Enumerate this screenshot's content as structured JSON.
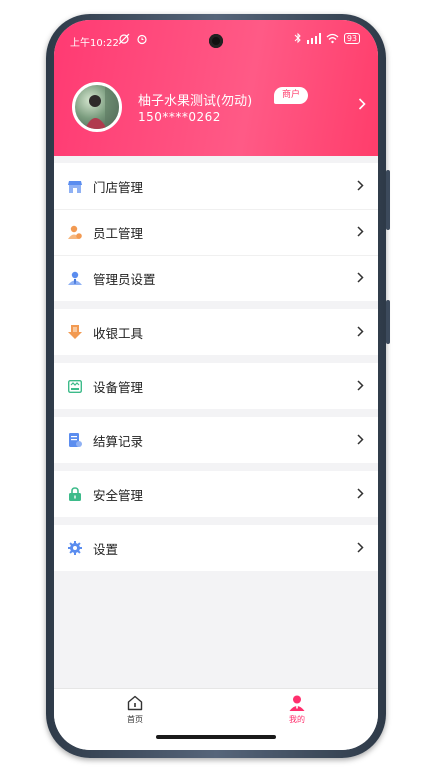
{
  "status_bar": {
    "time": "上午10:22",
    "battery": "93"
  },
  "profile": {
    "name": "柚子水果测试(勿动)",
    "role_badge": "商户",
    "phone": "150****0262"
  },
  "menu": {
    "groups": [
      [
        {
          "label": "门店管理",
          "icon": "store-icon",
          "color": "#5b8def"
        },
        {
          "label": "员工管理",
          "icon": "staff-icon",
          "color": "#f29a52"
        },
        {
          "label": "管理员设置",
          "icon": "admin-icon",
          "color": "#5b8def"
        }
      ],
      [
        {
          "label": "收银工具",
          "icon": "cashier-icon",
          "color": "#f29a52"
        }
      ],
      [
        {
          "label": "设备管理",
          "icon": "device-icon",
          "color": "#3dbb8a"
        }
      ],
      [
        {
          "label": "结算记录",
          "icon": "settlement-icon",
          "color": "#5b8def"
        }
      ],
      [
        {
          "label": "安全管理",
          "icon": "lock-icon",
          "color": "#3dbb8a"
        }
      ],
      [
        {
          "label": "设置",
          "icon": "gear-icon",
          "color": "#5b8def"
        }
      ]
    ]
  },
  "bottom_nav": {
    "home_label": "首页",
    "mine_label": "我的",
    "active": "mine",
    "active_color": "#ff2f6d"
  }
}
